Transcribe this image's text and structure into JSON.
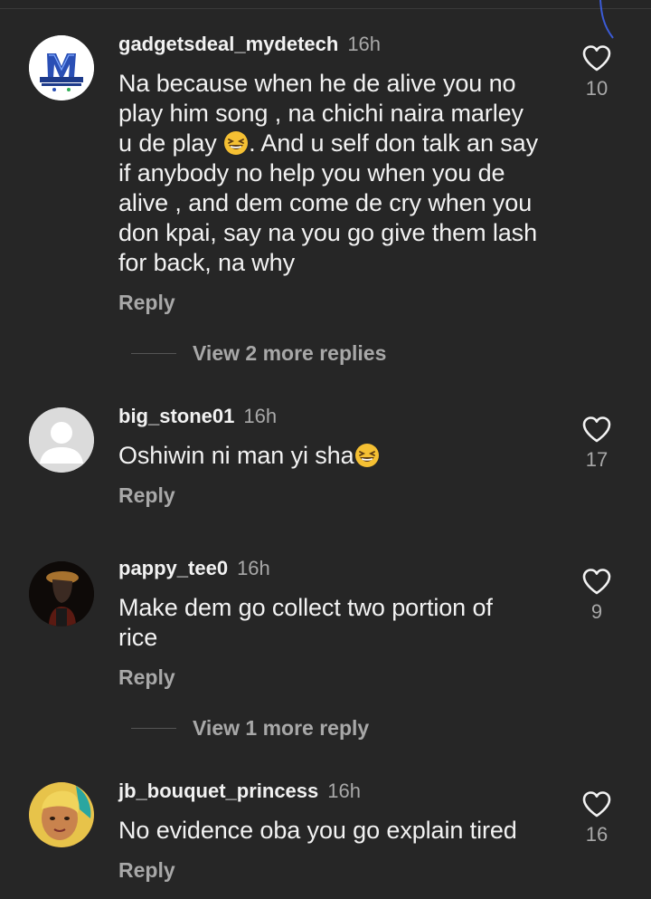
{
  "comments": [
    {
      "username": "gadgetsdeal_mydetech",
      "time": "16h",
      "text_lines": [
        "Na because when he de alive you no",
        "play him song , na chichi naira marley",
        "u de play",
        ". And u self don talk an say",
        "if anybody no help you when you de",
        "alive , and dem come de cry when you",
        "don kpai, say na you go give them lash",
        "for back, na why"
      ],
      "reply_label": "Reply",
      "likes": "10",
      "view_more": "View 2 more replies",
      "avatar_logo_text": "MYDE TECH COMMUNICATIONS"
    },
    {
      "username": "big_stone01",
      "time": "16h",
      "text": "Oshiwin ni man yi sha",
      "reply_label": "Reply",
      "likes": "17"
    },
    {
      "username": "pappy_tee0",
      "time": "16h",
      "text_lines": [
        "Make dem go collect two portion of",
        "rice"
      ],
      "reply_label": "Reply",
      "likes": "9",
      "view_more": "View 1 more reply"
    },
    {
      "username": "jb_bouquet_princess",
      "time": "16h",
      "text": "No evidence oba you go explain tired",
      "reply_label": "Reply",
      "likes": "16"
    }
  ],
  "icons": {
    "like": "heart-outline-icon",
    "emoji": "grinning-squinting-face-emoji"
  },
  "colors": {
    "background": "#262626",
    "text_primary": "#f2f2f2",
    "text_secondary": "#a8a8a8",
    "emoji_yellow": "#f5c033"
  }
}
